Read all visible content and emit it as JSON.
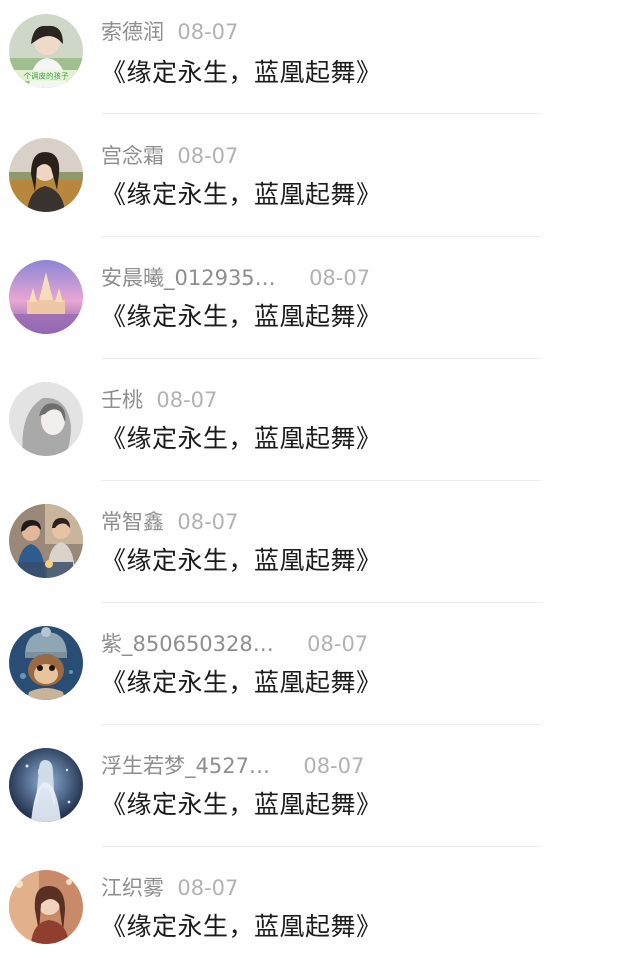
{
  "comments": [
    {
      "username": "索德润",
      "date": "08-07",
      "text": "《缘定永生，蓝凰起舞》",
      "avatar_icon": "girl-photo-avatar",
      "avatar_caption": "个调皮的孩子"
    },
    {
      "username": "宫念霜",
      "date": "08-07",
      "text": "《缘定永生，蓝凰起舞》",
      "avatar_icon": "woman-field-photo-avatar"
    },
    {
      "username": "安晨曦_012935…",
      "date": "08-07",
      "text": "《缘定永生，蓝凰起舞》",
      "avatar_icon": "purple-palace-avatar"
    },
    {
      "username": "壬桃",
      "date": "08-07",
      "text": "《缘定永生，蓝凰起舞》",
      "avatar_icon": "gray-girl-avatar"
    },
    {
      "username": "常智鑫",
      "date": "08-07",
      "text": "《缘定永生，蓝凰起舞》",
      "avatar_icon": "couple-photo-avatar"
    },
    {
      "username": "紫_850650328…",
      "date": "08-07",
      "text": "《缘定永生，蓝凰起舞》",
      "avatar_icon": "monkey-hat-avatar"
    },
    {
      "username": "浮生若梦_4527…",
      "date": "08-07",
      "text": "《缘定永生，蓝凰起舞》",
      "avatar_icon": "ghost-figure-avatar"
    },
    {
      "username": "江织雾",
      "date": "08-07",
      "text": "《缘定永生，蓝凰起舞》",
      "avatar_icon": "girl-street-avatar"
    }
  ]
}
